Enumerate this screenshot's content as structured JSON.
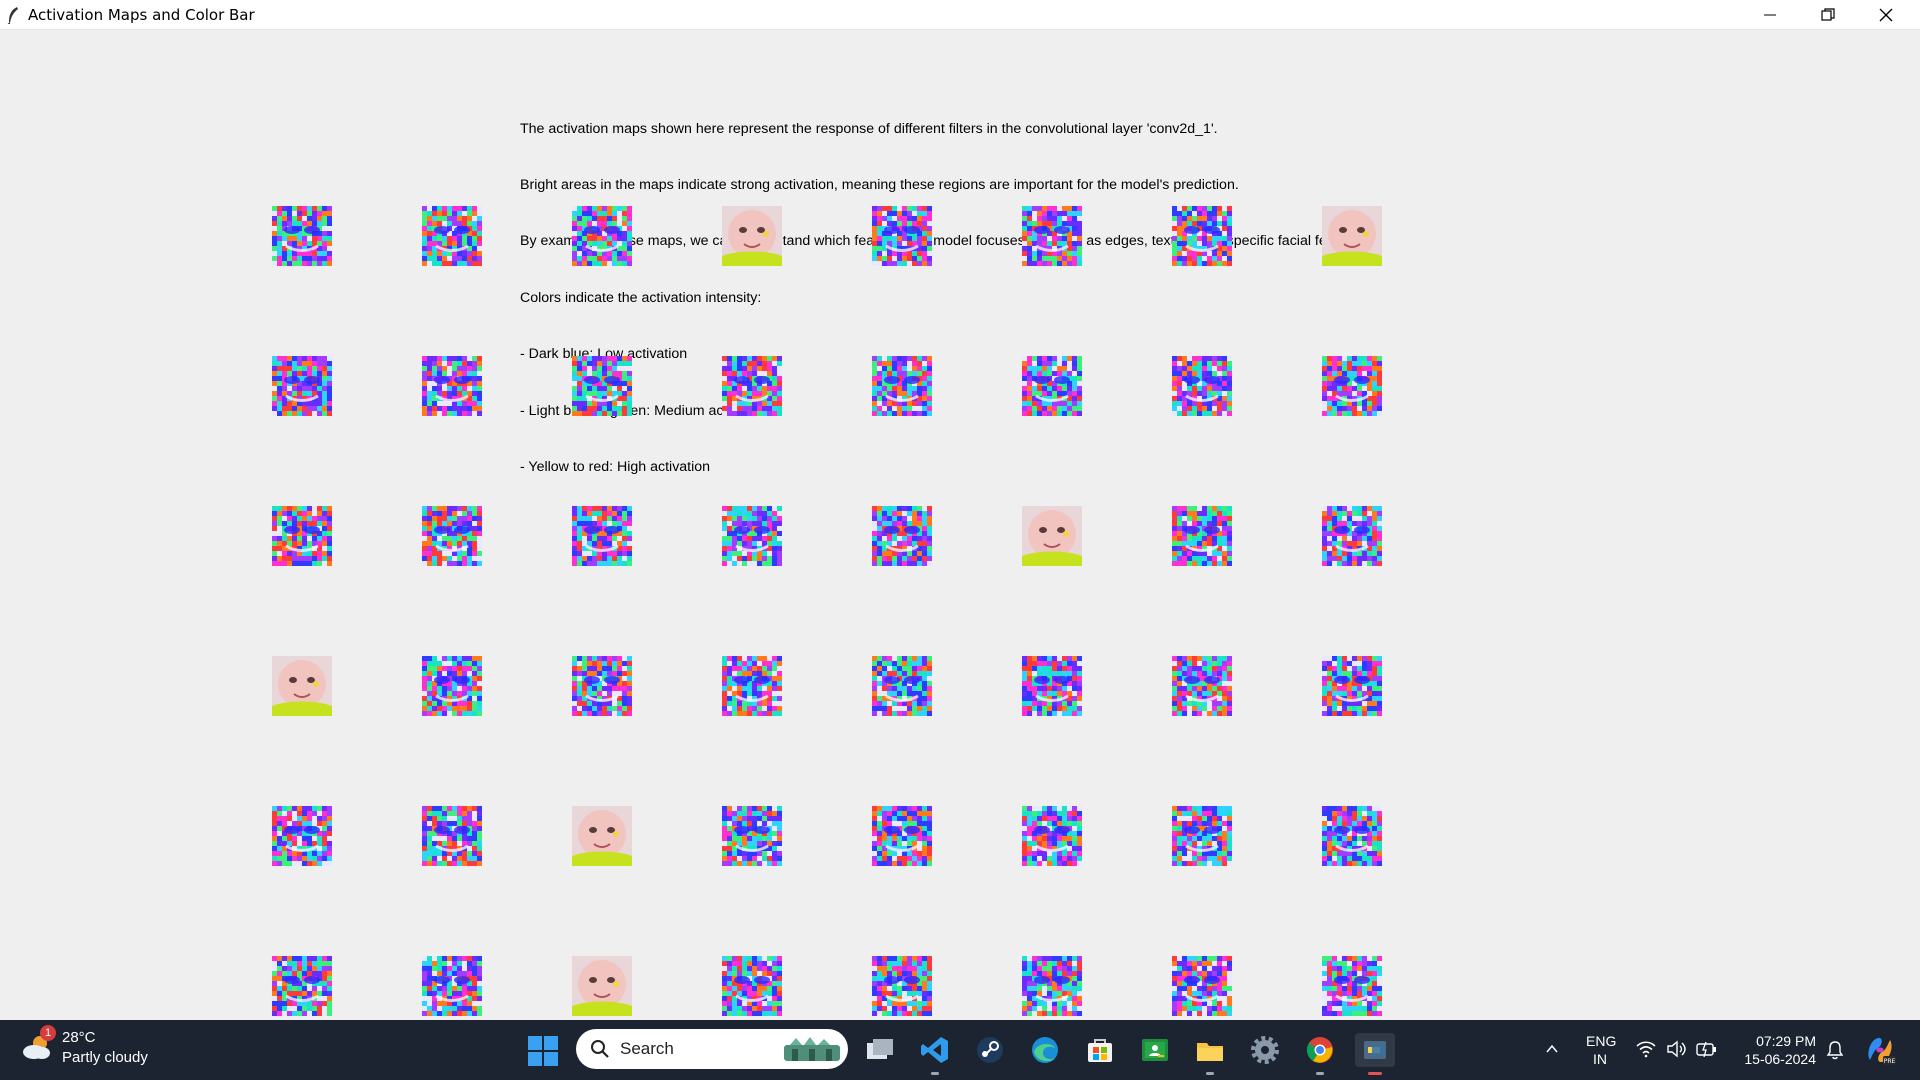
{
  "window": {
    "title": "Activation Maps and Color Bar"
  },
  "description": {
    "lines": [
      "The activation maps shown here represent the response of different filters in the convolutional layer 'conv2d_1'.",
      "Bright areas in the maps indicate strong activation, meaning these regions are important for the model's prediction.",
      "By examining these maps, we can understand which features the model focuses on, such as edges, textures, or specific facial features.",
      "Colors indicate the activation intensity:",
      "- Dark blue: Low activation",
      "- Light blue to green: Medium activation",
      "- Yellow to red: High activation"
    ]
  },
  "activation_grid": {
    "rows": 6,
    "cols": 8,
    "natural_tiles": [
      [
        0,
        3
      ],
      [
        0,
        7
      ],
      [
        2,
        5
      ],
      [
        3,
        0
      ],
      [
        4,
        2
      ],
      [
        5,
        2
      ]
    ]
  },
  "taskbar": {
    "weather": {
      "temp": "28°C",
      "condition": "Partly cloudy",
      "badge": "1"
    },
    "search_placeholder": "Search",
    "language": {
      "line1": "ENG",
      "line2": "IN"
    },
    "clock": {
      "time": "07:29 PM",
      "date": "15-06-2024"
    }
  }
}
